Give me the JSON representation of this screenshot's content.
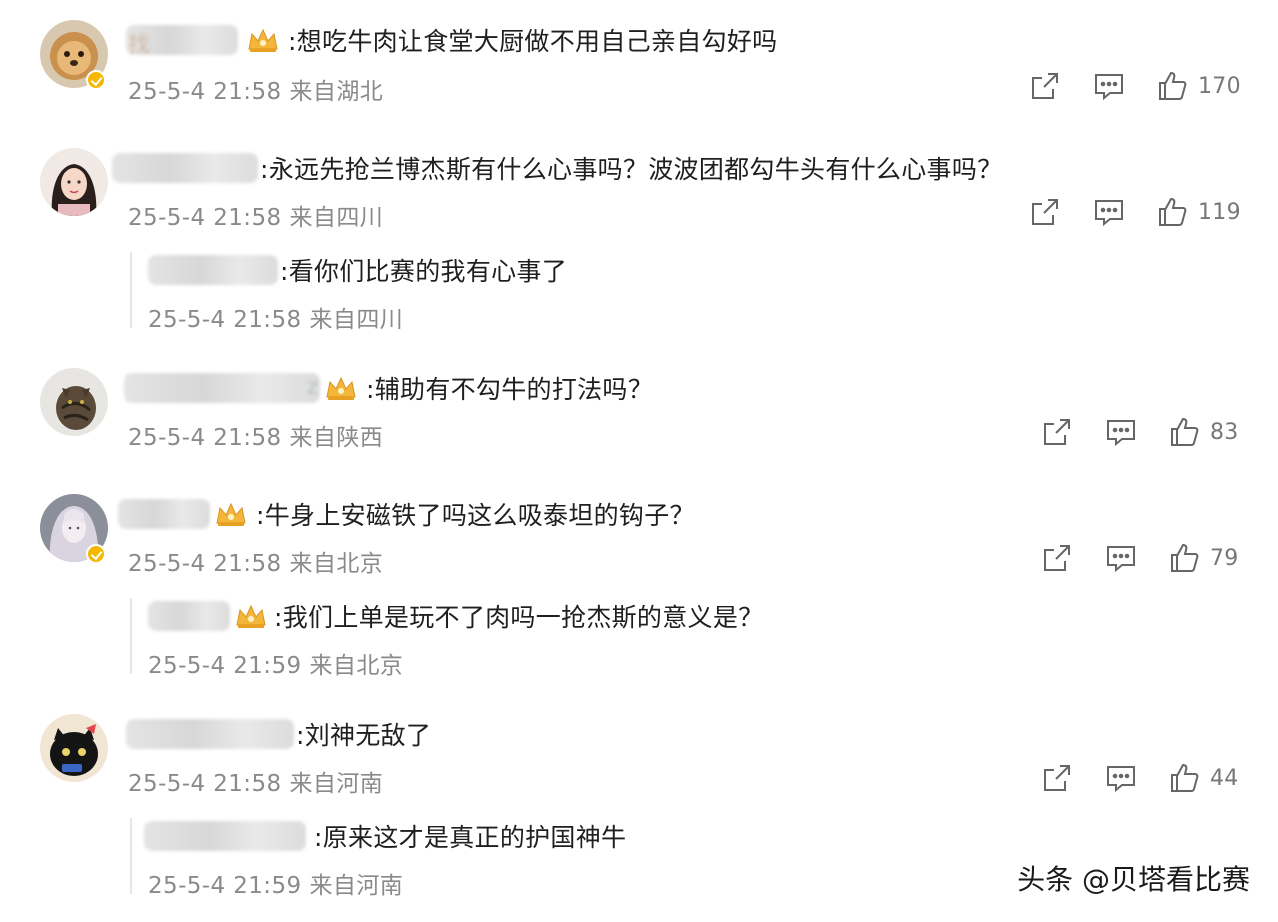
{
  "comments": [
    {
      "text": ":想吃牛肉让食堂大厨做不用自己亲自勾好吗",
      "date": "25-5-4 21:58",
      "location": "来自湖北",
      "likes": "170",
      "name_hint": "找"
    },
    {
      "text": ":永远先抢兰博杰斯有什么心事吗？波波团都勾牛头有什么心事吗？",
      "date": "25-5-4 21:58",
      "location": "来自四川",
      "likes": "119",
      "reply": {
        "text": ":看你们比赛的我有心事了",
        "date": "25-5-4 21:58",
        "location": "来自四川"
      }
    },
    {
      "text": ":辅助有不勾牛的打法吗？",
      "date": "25-5-4 21:58",
      "location": "来自陕西",
      "likes": "83",
      "name_hint_right": "z"
    },
    {
      "text": ":牛身上安磁铁了吗这么吸泰坦的钩子？",
      "date": "25-5-4 21:58",
      "location": "来自北京",
      "likes": "79",
      "reply": {
        "text": ":我们上单是玩不了肉吗一抢杰斯的意义是？",
        "date": "25-5-4 21:59",
        "location": "来自北京"
      }
    },
    {
      "text": ":刘神无敌了",
      "date": "25-5-4 21:58",
      "location": "来自河南",
      "likes": "44",
      "reply": {
        "text": ":原来这才是真正的护国神牛",
        "date": "25-5-4 21:59",
        "location": "来自河南"
      }
    }
  ],
  "watermark": "头条 @贝塔看比赛",
  "icons": {
    "share": "share-icon",
    "comment": "comment-icon",
    "like": "thumbs-up-icon",
    "crown": "crown-badge-icon",
    "verified": "verified-badge-icon"
  },
  "colors": {
    "meta_text": "#8a8a8a",
    "verified_badge": "#f5b800",
    "reply_bar": "#e6e6e6"
  }
}
